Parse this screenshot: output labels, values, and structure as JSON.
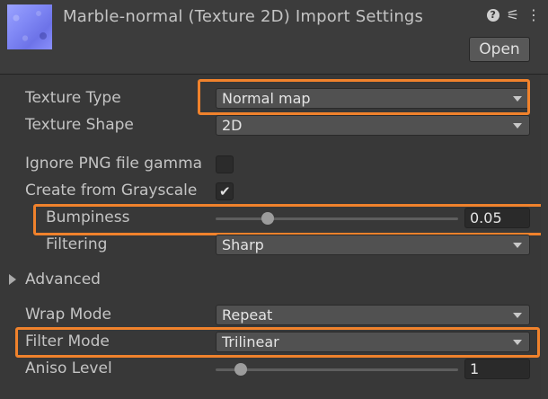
{
  "header": {
    "title": "Marble-normal (Texture 2D) Import Settings",
    "open_label": "Open",
    "icons": [
      "help-icon",
      "preset-icon",
      "more-icon"
    ]
  },
  "settings": {
    "texture_type": {
      "label": "Texture Type",
      "value": "Normal map"
    },
    "texture_shape": {
      "label": "Texture Shape",
      "value": "2D"
    },
    "ignore_png_gamma": {
      "label": "Ignore PNG file gamma",
      "checked": false
    },
    "create_from_grayscale": {
      "label": "Create from Grayscale",
      "checked": true
    },
    "bumpiness": {
      "label": "Bumpiness",
      "value": "0.05",
      "slider_fraction": 0.2
    },
    "filtering": {
      "label": "Filtering",
      "value": "Sharp"
    },
    "advanced": {
      "label": "Advanced",
      "expanded": false
    },
    "wrap_mode": {
      "label": "Wrap Mode",
      "value": "Repeat"
    },
    "filter_mode": {
      "label": "Filter Mode",
      "value": "Trilinear"
    },
    "aniso_level": {
      "label": "Aniso Level",
      "value": "1",
      "slider_fraction": 0.083
    }
  },
  "colors": {
    "highlight": "#f0822c",
    "background": "#383838"
  }
}
